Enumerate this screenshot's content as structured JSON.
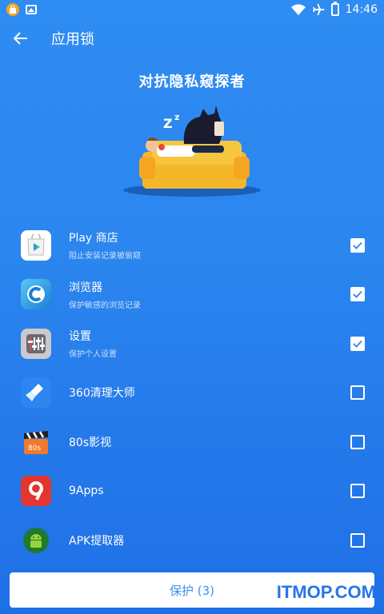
{
  "status_bar": {
    "time": "14:46"
  },
  "header": {
    "title": "应用锁"
  },
  "hero": {
    "title": "对抗隐私窥探者"
  },
  "apps": [
    {
      "name": "Play 商店",
      "desc": "阻止安装记录被偷窥",
      "checked": true,
      "icon": "play-store-icon"
    },
    {
      "name": "浏览器",
      "desc": "保护敏感的浏览记录",
      "checked": true,
      "icon": "browser-icon"
    },
    {
      "name": "设置",
      "desc": "保护个人设置",
      "checked": true,
      "icon": "settings-icon"
    },
    {
      "name": "360清理大师",
      "desc": "",
      "checked": false,
      "icon": "broom-icon"
    },
    {
      "name": "80s影视",
      "desc": "",
      "checked": false,
      "icon": "clapperboard-icon"
    },
    {
      "name": "9Apps",
      "desc": "",
      "checked": false,
      "icon": "nine-apps-icon"
    },
    {
      "name": "APK提取器",
      "desc": "",
      "checked": false,
      "icon": "android-icon"
    }
  ],
  "protect_button": {
    "label": "保护 (3)"
  },
  "watermark": "ITMOP.COM",
  "colors": {
    "background": "#2b86ef",
    "accent": "#3d8ff0"
  }
}
